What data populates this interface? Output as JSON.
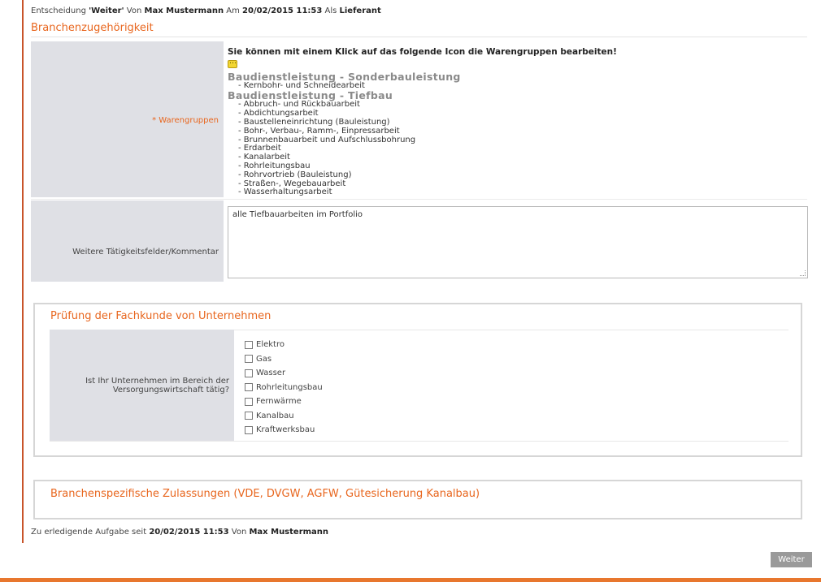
{
  "decision": {
    "prefix": "Entscheidung ",
    "action": "'Weiter'",
    "by": " Von ",
    "user": "Max Mustermann",
    "at": " Am ",
    "datetime": "20/02/2015 11:53",
    "as": " Als ",
    "role": "Lieferant"
  },
  "section": {
    "title": "Branchenzugehörigkeit"
  },
  "warengruppen": {
    "required_mark": "* ",
    "label": "Warengruppen",
    "intro": "Sie können mit einem Klick auf das folgende Icon die Warengruppen bearbeiten!",
    "edit_icon": "edit-icon",
    "groups": [
      {
        "title": "Baudienstleistung - Sonderbauleistung",
        "items": [
          "- Kernbohr- und Schneidearbeit"
        ]
      },
      {
        "title": "Baudienstleistung - Tiefbau",
        "items": [
          "- Abbruch- und Rückbauarbeit",
          "- Abdichtungsarbeit",
          "- Baustelleneinrichtung (Bauleistung)",
          "- Bohr-, Verbau-, Ramm-, Einpressarbeit",
          "- Brunnenbauarbeit und Aufschlussbohrung",
          "- Erdarbeit",
          "- Kanalarbeit",
          "- Rohrleitungsbau",
          "- Rohrvortrieb (Bauleistung)",
          "- Straßen-, Wegebauarbeit",
          "- Wasserhaltungsarbeit"
        ]
      }
    ]
  },
  "comment": {
    "label": "Weitere Tätigkeitsfelder/Kommentar",
    "value": "alle Tiefbauarbeiten im Portfolio"
  },
  "fachkunde": {
    "title": "Prüfung der Fachkunde von Unternehmen",
    "question_line1": "Ist Ihr Unternehmen im Bereich der",
    "question_line2": "Versorgungswirtschaft tätig?",
    "options": [
      "Elektro",
      "Gas",
      "Wasser",
      "Rohrleitungsbau",
      "Fernwärme",
      "Kanalbau",
      "Kraftwerksbau"
    ]
  },
  "zulassungen": {
    "title": "Branchenspezifische Zulassungen (VDE, DVGW, AGFW, Gütesicherung Kanalbau)"
  },
  "todo": {
    "prefix": "Zu erledigende Aufgabe seit ",
    "datetime": "20/02/2015 11:53",
    "by": " Von ",
    "user": "Max Mustermann"
  },
  "actions": {
    "next_label": "Weiter"
  },
  "colors": {
    "accent": "#e8661e",
    "border_left": "#c8542a",
    "label_bg": "#dfe0e5",
    "button_bg": "#9a9a9a"
  }
}
